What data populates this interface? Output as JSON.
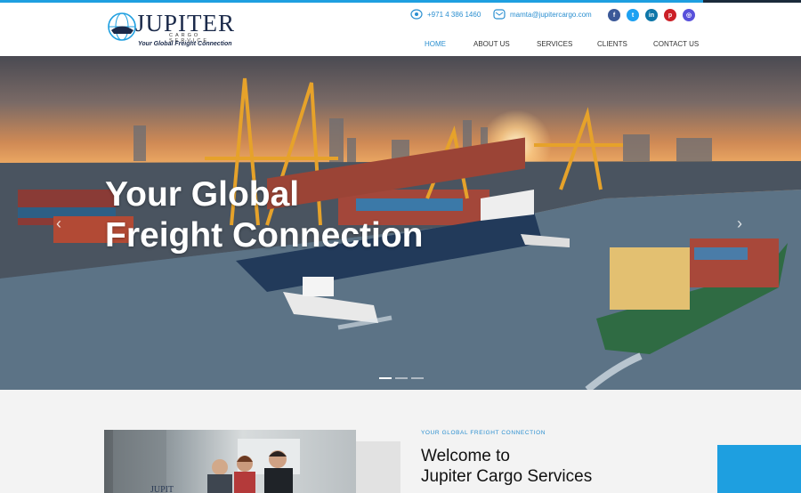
{
  "brand": {
    "name": "JUPITER",
    "subtitle": "CARGO SERVICE",
    "tagline": "Your Global Freight Connection"
  },
  "contact": {
    "phone": "+971 4 386 1460",
    "email": "mamta@jupitercargo.com"
  },
  "socials": [
    {
      "name": "facebook",
      "glyph": "f",
      "color": "#3b5998"
    },
    {
      "name": "twitter",
      "glyph": "t",
      "color": "#1da1f2"
    },
    {
      "name": "linkedin",
      "glyph": "in",
      "color": "#0e76a8"
    },
    {
      "name": "pinterest",
      "glyph": "p",
      "color": "#cb2027"
    },
    {
      "name": "instagram",
      "glyph": "◎",
      "color": "#5851db"
    }
  ],
  "nav": {
    "home": "HOME",
    "about": "ABOUT US",
    "services": "SERVICES",
    "clients": "CLIENTS",
    "contact": "CONTACT US"
  },
  "hero": {
    "line1": "Your Global",
    "line2": "Freight Connection",
    "prev_glyph": "‹",
    "next_glyph": "›"
  },
  "about": {
    "eyebrow": "YOUR GLOBAL FREIGHT CONNECTION",
    "title_line1": "Welcome to",
    "title_line2": "Jupiter Cargo Services",
    "photo_logo": "JUPIT"
  },
  "colors": {
    "accent": "#1e9fe0",
    "link": "#2b8fd0",
    "dark": "#1b2a3a"
  }
}
